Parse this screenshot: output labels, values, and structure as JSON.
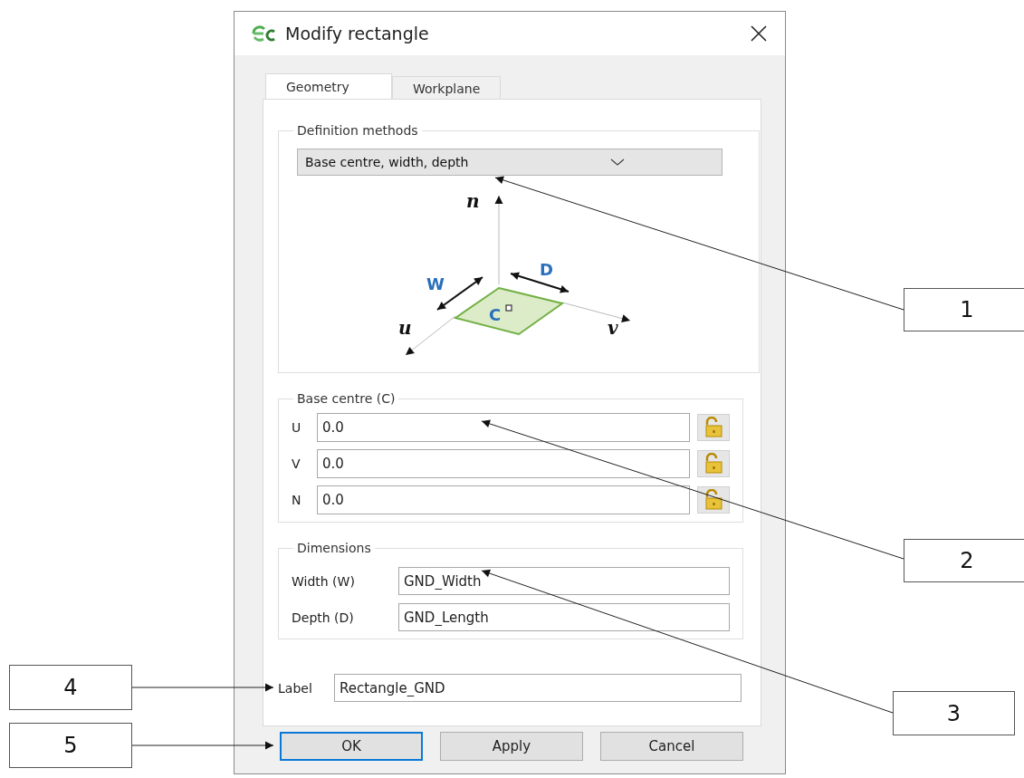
{
  "window": {
    "title": "Modify rectangle"
  },
  "tabs": [
    {
      "label": "Geometry",
      "selected": true
    },
    {
      "label": "Workplane",
      "selected": false
    }
  ],
  "definition_methods": {
    "title": "Definition methods",
    "value": "Base centre, width, depth",
    "diagram_labels": {
      "normal": "n",
      "u": "u",
      "v": "v",
      "width": "W",
      "depth": "D",
      "centre": "C"
    }
  },
  "base_centre": {
    "title": "Base centre (C)",
    "fields": [
      {
        "label": "U",
        "value": "0.0",
        "locked": false
      },
      {
        "label": "V",
        "value": "0.0",
        "locked": false
      },
      {
        "label": "N",
        "value": "0.0",
        "locked": false
      }
    ]
  },
  "dimensions": {
    "title": "Dimensions",
    "fields": [
      {
        "label": "Width (W)",
        "value": "GND_Width"
      },
      {
        "label": "Depth (D)",
        "value": "GND_Length"
      }
    ]
  },
  "label_field": {
    "label": "Label",
    "value": "Rectangle_GND"
  },
  "buttons": [
    {
      "label": "OK",
      "focused": true
    },
    {
      "label": "Apply",
      "focused": false
    },
    {
      "label": "Cancel",
      "focused": false
    }
  ],
  "callouts": [
    {
      "number": "1"
    },
    {
      "number": "2"
    },
    {
      "number": "3"
    },
    {
      "number": "4"
    },
    {
      "number": "5"
    }
  ]
}
